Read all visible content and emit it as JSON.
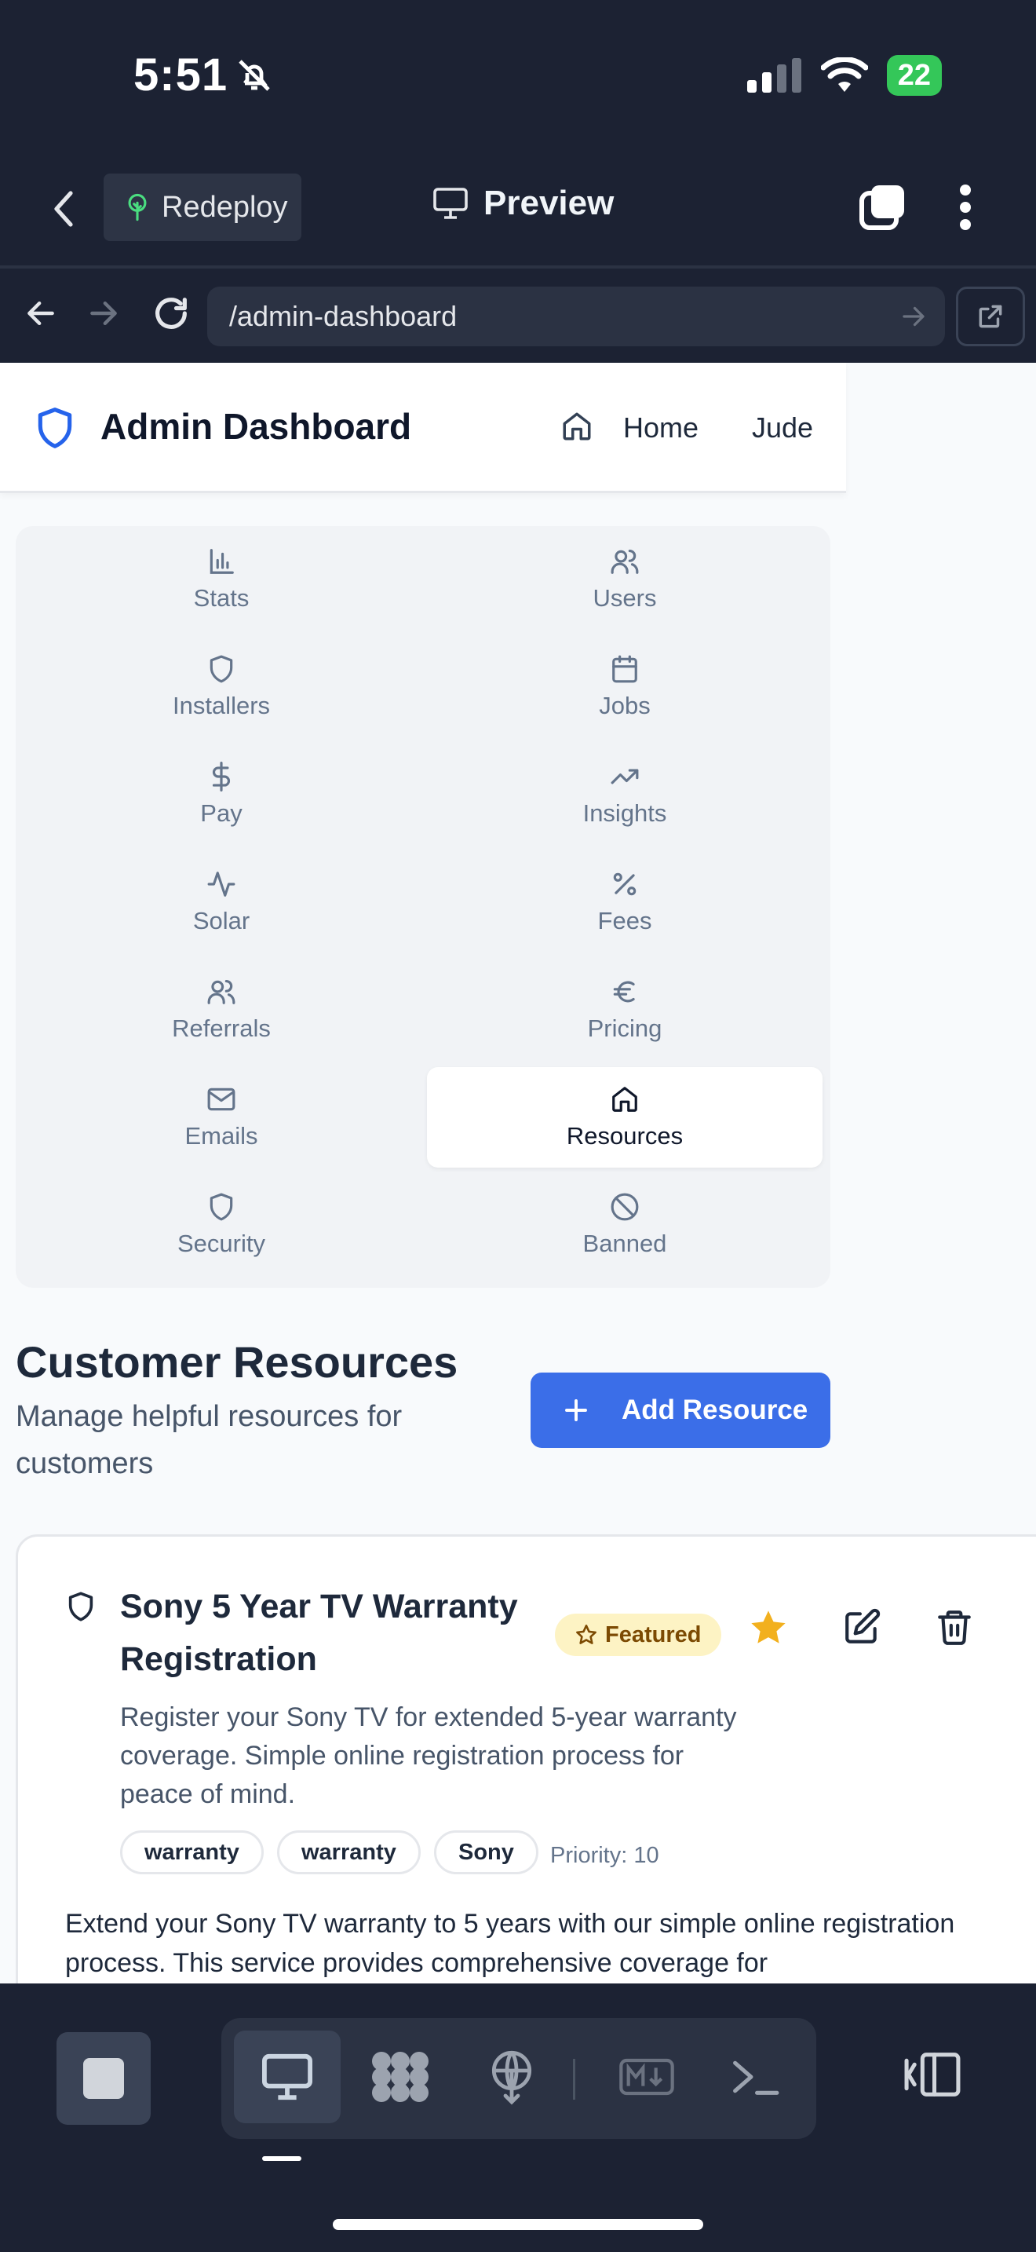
{
  "status": {
    "time": "5:51",
    "battery": "22"
  },
  "topbar": {
    "redeploy_label": "Redeploy",
    "preview_label": "Preview"
  },
  "urlbar": {
    "url": "/admin-dashboard"
  },
  "app": {
    "title": "Admin Dashboard",
    "home_label": "Home",
    "user_label": "Jude"
  },
  "nav": {
    "items": [
      {
        "label": "Stats",
        "icon": "bar-chart-icon"
      },
      {
        "label": "Users",
        "icon": "users-icon"
      },
      {
        "label": "Installers",
        "icon": "shield-icon"
      },
      {
        "label": "Jobs",
        "icon": "calendar-icon"
      },
      {
        "label": "Pay",
        "icon": "dollar-icon"
      },
      {
        "label": "Insights",
        "icon": "trending-up-icon"
      },
      {
        "label": "Solar",
        "icon": "activity-icon"
      },
      {
        "label": "Fees",
        "icon": "percent-icon"
      },
      {
        "label": "Referrals",
        "icon": "users-icon"
      },
      {
        "label": "Pricing",
        "icon": "euro-icon"
      },
      {
        "label": "Emails",
        "icon": "mail-icon"
      },
      {
        "label": "Resources",
        "icon": "home-icon"
      },
      {
        "label": "Security",
        "icon": "shield-icon"
      },
      {
        "label": "Banned",
        "icon": "ban-icon"
      }
    ],
    "active": "Resources"
  },
  "section": {
    "title": "Customer Resources",
    "subtitle": "Manage helpful resources for customers",
    "add_button": "Add Resource"
  },
  "resource": {
    "title": "Sony 5 Year TV Warranty Registration",
    "badge": "Featured",
    "description": "Register your Sony TV for extended 5-year warranty coverage. Simple online registration process for peace of mind.",
    "tags": [
      "warranty",
      "warranty",
      "Sony"
    ],
    "priority": "Priority: 10",
    "body": "Extend your Sony TV warranty to 5 years with our simple online registration process. This service provides comprehensive coverage for"
  },
  "colors": {
    "accent": "#3b6ee8",
    "chrome_bg": "#1c2233",
    "featured_bg": "#fdf3c4",
    "star": "#f2b01e",
    "battery": "#34c759"
  }
}
